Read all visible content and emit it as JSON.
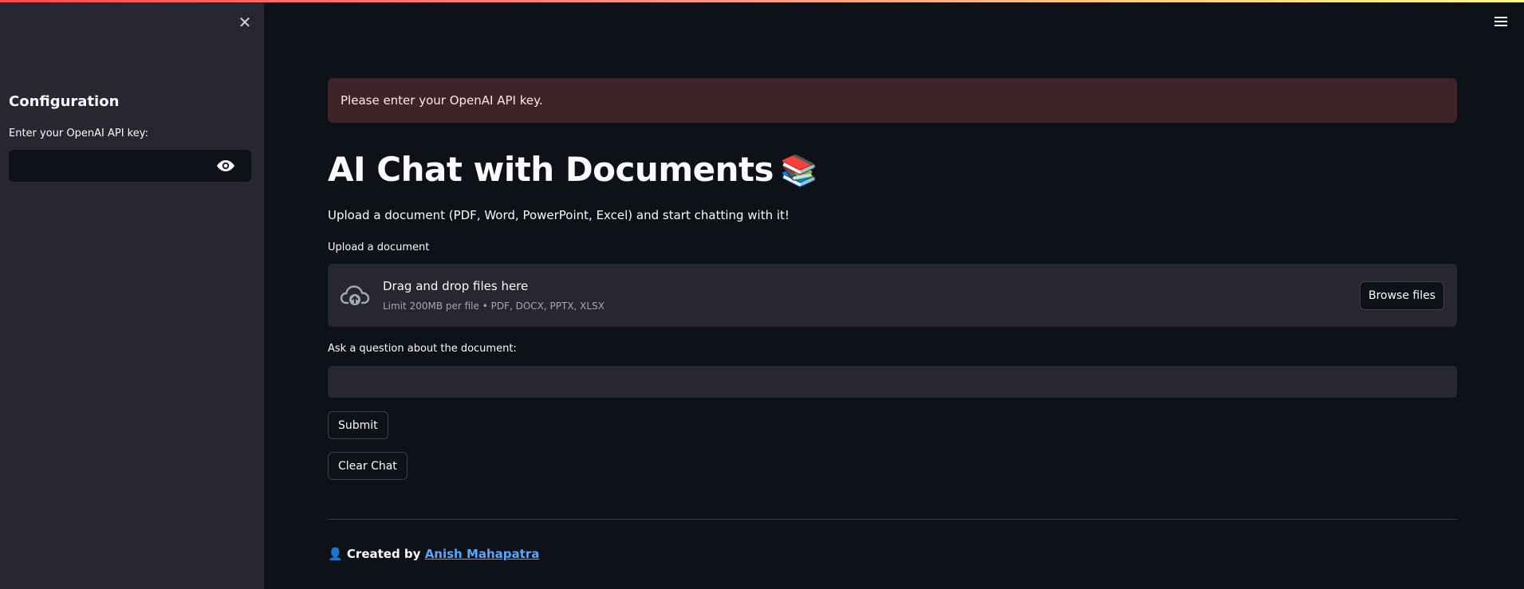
{
  "sidebar": {
    "heading": "Configuration",
    "api_key_label": "Enter your OpenAI API key:",
    "api_key_value": "",
    "close_icon": "close-icon",
    "visibility_icon": "eye-icon"
  },
  "header": {
    "menu_icon": "hamburger-menu-icon"
  },
  "main": {
    "alert_text": "Please enter your OpenAI API key.",
    "title": "AI Chat with Documents",
    "title_emoji": "📚",
    "subtitle": "Upload a document (PDF, Word, PowerPoint, Excel) and start chatting with it!",
    "upload_label": "Upload a document",
    "dropzone": {
      "title": "Drag and drop files here",
      "limit": "Limit 200MB per file • PDF, DOCX, PPTX, XLSX",
      "browse_label": "Browse files"
    },
    "question_label": "Ask a question about the document:",
    "question_value": "",
    "submit_label": "Submit",
    "clear_label": "Clear Chat"
  },
  "footer": {
    "emoji": "👤",
    "prefix": "Created by",
    "author": "Anish Mahapatra"
  },
  "colors": {
    "background": "#0e1117",
    "sidebar": "#262730",
    "alert_bg": "#3e2428",
    "link": "#58a6ff"
  }
}
